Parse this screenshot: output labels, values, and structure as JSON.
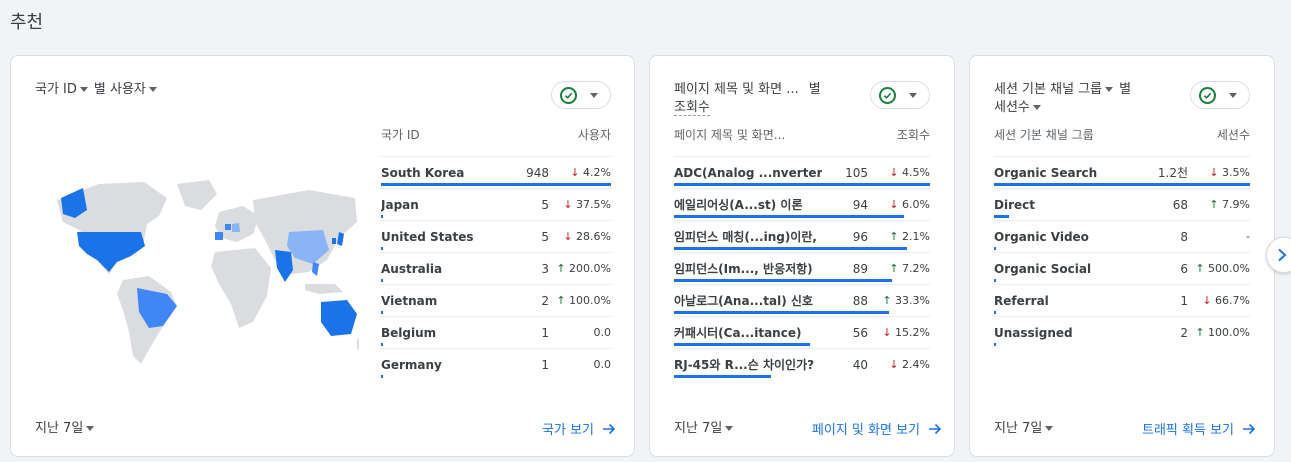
{
  "page": {
    "title": "추천"
  },
  "card1": {
    "title_dim": "국가 ID",
    "title_by": "별 사용자",
    "col1": "국가 ID",
    "col2": "사용자",
    "rows": [
      {
        "name": "South Korea",
        "value": "948",
        "dir": "down",
        "change": "4.2%",
        "bar": 1.0
      },
      {
        "name": "Japan",
        "value": "5",
        "dir": "down",
        "change": "37.5%",
        "bar": 0.005
      },
      {
        "name": "United States",
        "value": "5",
        "dir": "down",
        "change": "28.6%",
        "bar": 0.005
      },
      {
        "name": "Australia",
        "value": "3",
        "dir": "up",
        "change": "200.0%",
        "bar": 0.003
      },
      {
        "name": "Vietnam",
        "value": "2",
        "dir": "up",
        "change": "100.0%",
        "bar": 0.002
      },
      {
        "name": "Belgium",
        "value": "1",
        "dir": "none",
        "change": "0.0",
        "bar": 0.001
      },
      {
        "name": "Germany",
        "value": "1",
        "dir": "none",
        "change": "0.0",
        "bar": 0.001
      }
    ],
    "period": "지난 7일",
    "link": "국가 보기",
    "map_colors": {
      "land": "#dadce0",
      "high": "#1a73e8",
      "mid": "#4285f4",
      "low": "#8ab4f8"
    }
  },
  "card2": {
    "title_line1": "페이지 제목 및 화면 ...",
    "title_by": "별",
    "title_line2": "조회수",
    "col1": "페이지 제목 및 화면...",
    "col2": "조회수",
    "rows": [
      {
        "name": "ADC(Analog ...nverter)란,",
        "value": "105",
        "dir": "down",
        "change": "4.5%",
        "bar": 1.0
      },
      {
        "name": "에일리어싱(A...st) 이론",
        "value": "94",
        "dir": "down",
        "change": "6.0%",
        "bar": 0.9
      },
      {
        "name": "임피던스 매칭(...ing)이란,",
        "value": "96",
        "dir": "up",
        "change": "2.1%",
        "bar": 0.91
      },
      {
        "name": "임피던스(Im..., 반응저항)",
        "value": "89",
        "dir": "up",
        "change": "7.2%",
        "bar": 0.85
      },
      {
        "name": "아날로그(Ana...tal) 신호",
        "value": "88",
        "dir": "up",
        "change": "33.3%",
        "bar": 0.84
      },
      {
        "name": "커패시터(Ca...itance)",
        "value": "56",
        "dir": "down",
        "change": "15.2%",
        "bar": 0.53
      },
      {
        "name": "RJ-45와 R...슨 차이인가?",
        "value": "40",
        "dir": "down",
        "change": "2.4%",
        "bar": 0.38
      }
    ],
    "period": "지난 7일",
    "link": "페이지 및 화면 보기"
  },
  "card3": {
    "title_line1": "세션 기본 채널 그룹",
    "title_by": "별",
    "title_line2": "세션수",
    "col1": "세션 기본 채널 그룹",
    "col2": "세션수",
    "rows": [
      {
        "name": "Organic Search",
        "value": "1.2천",
        "dir": "down",
        "change": "3.5%",
        "bar": 1.0
      },
      {
        "name": "Direct",
        "value": "68",
        "dir": "up",
        "change": "7.9%",
        "bar": 0.057
      },
      {
        "name": "Organic Video",
        "value": "8",
        "dir": "none",
        "change": "-",
        "bar": 0.007
      },
      {
        "name": "Organic Social",
        "value": "6",
        "dir": "up",
        "change": "500.0%",
        "bar": 0.005
      },
      {
        "name": "Referral",
        "value": "1",
        "dir": "down",
        "change": "66.7%",
        "bar": 0.001
      },
      {
        "name": "Unassigned",
        "value": "2",
        "dir": "up",
        "change": "100.0%",
        "bar": 0.002
      }
    ],
    "period": "지난 7일",
    "link": "트래픽 획득 보기"
  },
  "icons": {
    "check": "check-circle-icon",
    "chevron_down": "chevron-down-icon",
    "arrow_right": "arrow-right-icon",
    "next": "chevron-right-icon"
  }
}
